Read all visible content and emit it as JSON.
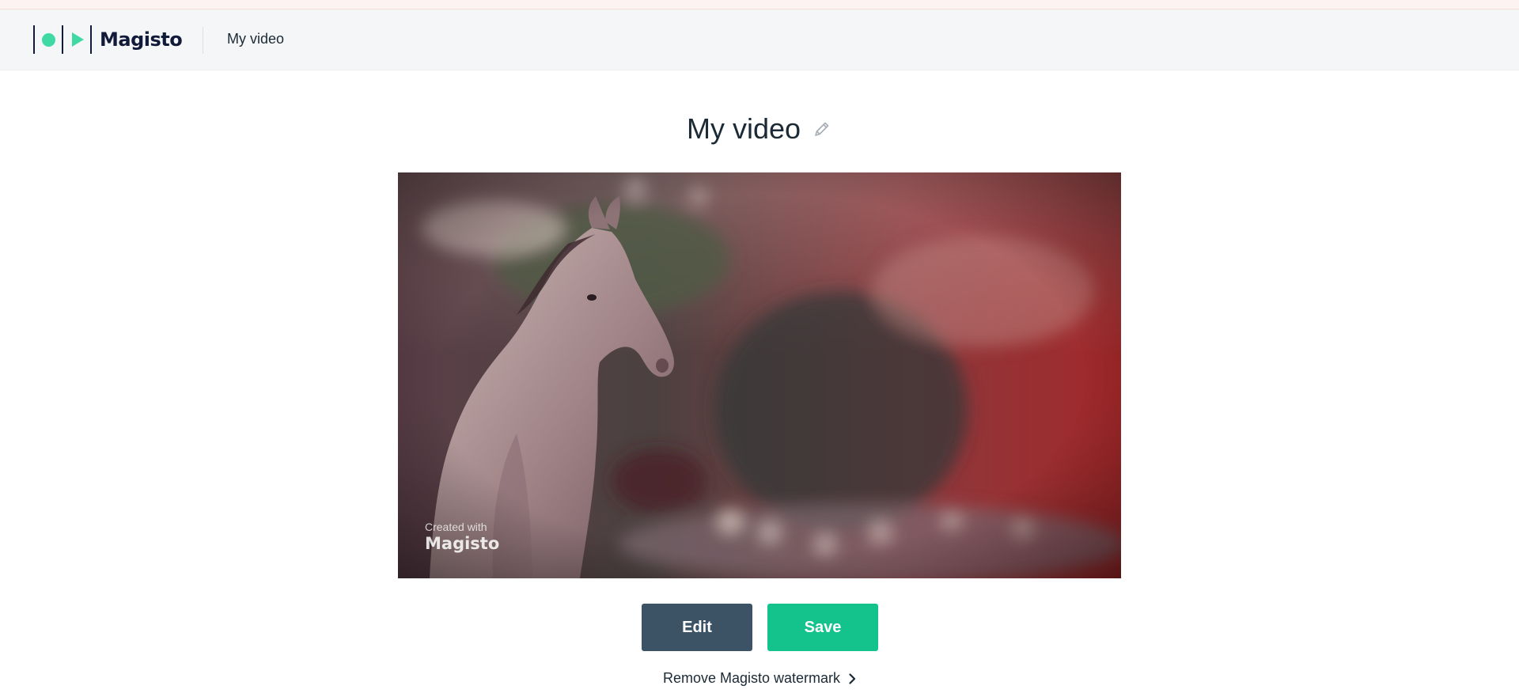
{
  "header": {
    "logo_text": "Magisto",
    "page_title": "My video"
  },
  "main": {
    "video_title": "My video",
    "edit_title_icon": "pencil-icon",
    "video": {
      "watermark_small": "Created with",
      "watermark_brand": "Magisto"
    },
    "edit_button": "Edit",
    "save_button": "Save",
    "remove_watermark_link": "Remove Magisto watermark",
    "remove_watermark_icon": "chevron-right-icon"
  },
  "colors": {
    "brand_green": "#14c38c",
    "edit_button": "#3b5365",
    "logo_accent": "#3fd9a3",
    "logo_dark": "#121a3a",
    "text": "#1b2a35"
  }
}
